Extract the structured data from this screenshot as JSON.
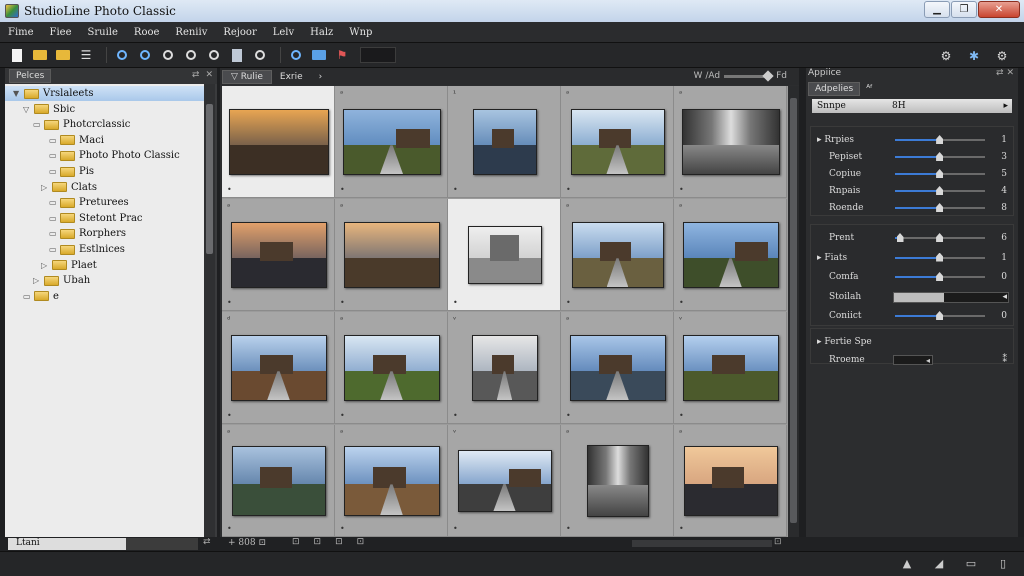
{
  "window": {
    "title": "StudioLine Photo Classic",
    "minimize": "▁",
    "maximize": "❐",
    "close": "✕"
  },
  "menu": [
    "Fime",
    "Fiee",
    "Sruile",
    "Rooe",
    "Reniiv",
    "Rejoor",
    "Lelv",
    "Halz",
    "Wnp"
  ],
  "toolbar": {
    "icons": [
      "new-document-icon",
      "open-folder-icon",
      "folder-icon",
      "list-icon",
      "search-blue-icon",
      "search-blue-icon",
      "zoom-in-icon",
      "zoom-out-icon",
      "search-icon",
      "image-icon",
      "search-icon",
      "find-icon",
      "folder-blue-icon",
      "flag-icon"
    ],
    "right_icons": [
      "settings-icon",
      "tools-icon",
      "gear-icon"
    ]
  },
  "left_panel": {
    "tab": "Pelces",
    "tab_icons": [
      "⇄",
      "✕"
    ],
    "tree": [
      {
        "label": "Vrslaleets",
        "twisty": "▼",
        "selected": true
      },
      {
        "label": "Sbic",
        "twisty": "▽"
      },
      {
        "label": "Photcrclassic",
        "twisty": "▭"
      },
      {
        "label": "Maci",
        "twisty": "▭"
      },
      {
        "label": "Photo Photo Classic",
        "twisty": "▭"
      },
      {
        "label": "Pis",
        "twisty": "▭"
      },
      {
        "label": "Clats",
        "twisty": "▷"
      },
      {
        "label": "Preturees",
        "twisty": "▭"
      },
      {
        "label": "Stetont Prac",
        "twisty": "▭"
      },
      {
        "label": "Rorphers",
        "twisty": "▭"
      },
      {
        "label": "Estlnices",
        "twisty": "▭"
      },
      {
        "label": "Plaet",
        "twisty": "▷"
      },
      {
        "label": "Ubah",
        "twisty": "▷"
      },
      {
        "label": "e",
        "twisty": "▭"
      }
    ]
  },
  "center": {
    "tabs": [
      "Rulie",
      "Exrie"
    ],
    "tab_arrow": "›",
    "zoom_label": "Ꮃ /Ad",
    "zoom_extra": "Fd",
    "zoom_fraction": 1.0,
    "cell_nums": [
      "",
      "ᵃ",
      "¹",
      "ᵃ",
      "ᵃ",
      "ᵃ",
      "ᵃ",
      "",
      "ᵃ",
      "ᵃ",
      "ᵈ",
      "ᵃ",
      "ᵛ",
      "ᵃ",
      "ᵛ",
      "ᵃ",
      "ᵃ",
      "ᵛ",
      "ᵃ",
      "ᵃ"
    ],
    "selected_cells": [
      0,
      7
    ],
    "photos": [
      {
        "sky": [
          "#e8a552",
          "#1f2a44"
        ],
        "ground": "#3c2f24",
        "kind": "sunset"
      },
      {
        "sky": [
          "#8fb3dc",
          "#3b6ea8"
        ],
        "ground": "#4a5a2c",
        "kind": "street"
      },
      {
        "sky": [
          "#a8c4e0",
          "#2f5f99"
        ],
        "ground": "#2d3b4d",
        "kind": "reflect"
      },
      {
        "sky": [
          "#d9e6f2",
          "#4c7fb6"
        ],
        "ground": "#5f6b3a",
        "kind": "field"
      },
      {
        "sky": [
          "#cfcfcf",
          "#7a7a7a"
        ],
        "ground": "#6b6b6b",
        "kind": "interior"
      },
      {
        "sky": [
          "#e2a06a",
          "#203355"
        ],
        "ground": "#2a2a30",
        "kind": "reflect"
      },
      {
        "sky": [
          "#e7b57d",
          "#27426b"
        ],
        "ground": "#4a3a2a",
        "kind": "sunset"
      },
      {
        "sky": [
          "#eeeeee",
          "#bcbcbc"
        ],
        "ground": "#8a8a8a",
        "kind": "church"
      },
      {
        "sky": [
          "#c9dcef",
          "#3f6ea9"
        ],
        "ground": "#6a6040",
        "kind": "field"
      },
      {
        "sky": [
          "#8fb5e0",
          "#2f5e9b"
        ],
        "ground": "#3e4e2a",
        "kind": "street"
      },
      {
        "sky": [
          "#b9d1ec",
          "#2c5a94"
        ],
        "ground": "#6a4a30",
        "kind": "field"
      },
      {
        "sky": [
          "#d8e6f2",
          "#5780b6"
        ],
        "ground": "#4e6a2e",
        "kind": "road"
      },
      {
        "sky": [
          "#e6e6e6",
          "#7e8ea2"
        ],
        "ground": "#585858",
        "kind": "road"
      },
      {
        "sky": [
          "#a9c6e8",
          "#2b5a98"
        ],
        "ground": "#3a4a5a",
        "kind": "road"
      },
      {
        "sky": [
          "#b4cfee",
          "#2e5d9a"
        ],
        "ground": "#4c5a2c",
        "kind": "reflect"
      },
      {
        "sky": [
          "#a9c2de",
          "#2d5584"
        ],
        "ground": "#3a4f3a",
        "kind": "reflect"
      },
      {
        "sky": [
          "#bcd3ee",
          "#2b5b98"
        ],
        "ground": "#7a5a3a",
        "kind": "road"
      },
      {
        "sky": [
          "#dfe9f4",
          "#3e6fae"
        ],
        "ground": "#3e3e3e",
        "kind": "street"
      },
      {
        "sky": [
          "#d7d7d7",
          "#7b7b7b"
        ],
        "ground": "#5c5c5c",
        "kind": "interior"
      },
      {
        "sky": [
          "#f0c89a",
          "#c4896a"
        ],
        "ground": "#2b2b30",
        "kind": "reflect"
      }
    ]
  },
  "right_panel": {
    "header": "Appiice",
    "header_icons": "⇄ ✕",
    "tabs": [
      "Adpelies",
      "ᴬᶠ"
    ],
    "preset": {
      "label": "Snnpe",
      "value": "8H",
      "arrow": "▸"
    },
    "group1": [
      {
        "label": "▸  Rrpies",
        "value": "1",
        "level": 0.49
      },
      {
        "label": "Pepiset",
        "value": "3",
        "level": 0.49
      },
      {
        "label": "Copiue",
        "value": "5",
        "level": 0.49
      },
      {
        "label": "Rnpais",
        "value": "4",
        "level": 0.49
      },
      {
        "label": "Roende",
        "value": "8",
        "level": 0.49
      }
    ],
    "group2": [
      {
        "label": "Prent",
        "value": "6",
        "level": 0.05,
        "level2": 0.49
      },
      {
        "label": "▸  Fiats",
        "value": "1",
        "level": 0.49
      },
      {
        "label": "Comfa",
        "value": "0",
        "level": 0.49
      },
      {
        "label": "Stoilah",
        "value": "◂",
        "bar": 0.44
      },
      {
        "label": "Coniict",
        "value": "0",
        "level": 0.49
      }
    ],
    "group3": [
      {
        "label": "▸  Fertie Spe"
      },
      {
        "label": "Rroeme",
        "value": "⁑",
        "mini": "◂"
      }
    ]
  },
  "statusbar": {
    "left": "Ltani",
    "left_x": "⇄",
    "count": "+ 808  ⊡",
    "icons": [
      "⊡",
      "⊡",
      "⊡",
      "⊡"
    ],
    "right": "⊡"
  },
  "bottombar": {
    "icons": [
      "▲",
      "◢",
      "▭",
      "▯"
    ]
  }
}
